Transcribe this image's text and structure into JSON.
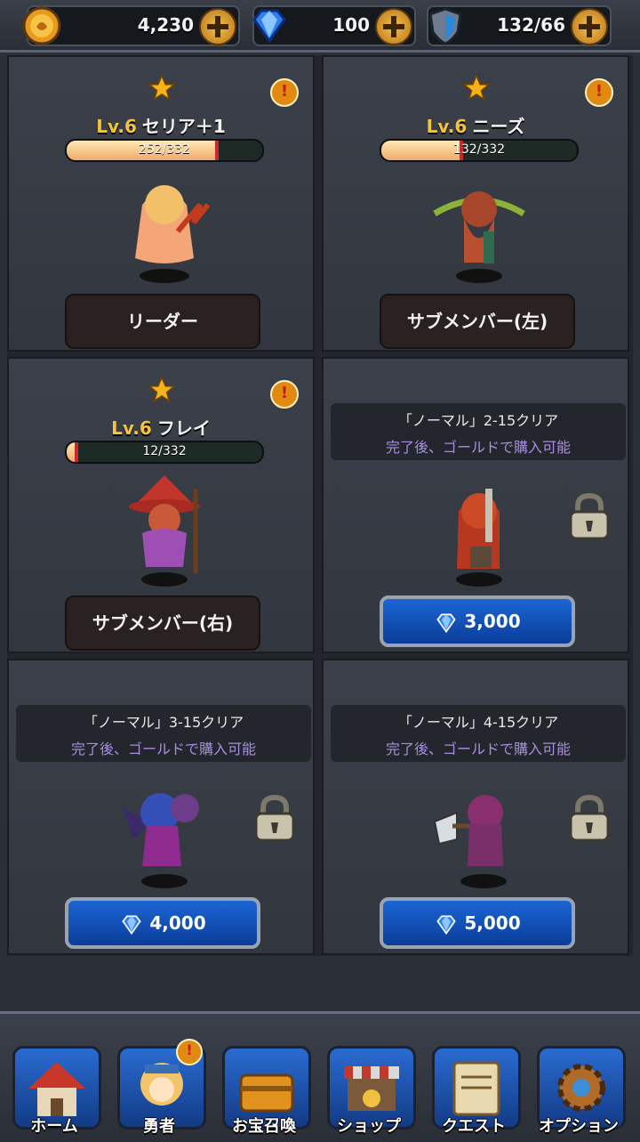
{
  "top_bar": {
    "gold": "4,230",
    "gems": "100",
    "stamina": "132/66"
  },
  "heroes": [
    {
      "lv": "Lv.6",
      "name": "セリア＋1",
      "xp": "252/332",
      "xp_fraction": 0.76,
      "slot": "リーダー"
    },
    {
      "lv": "Lv.6",
      "name": "ニーズ",
      "xp": "132/332",
      "xp_fraction": 0.4,
      "slot": "サブメンバー(左)"
    },
    {
      "lv": "Lv.6",
      "name": "フレイ",
      "xp": "12/332",
      "xp_fraction": 0.04,
      "slot": "サブメンバー(右)"
    }
  ],
  "locked": [
    {
      "condition": "「ノーマル」2-15クリア",
      "note": "完了後、ゴールドで購入可能",
      "price": "3,000"
    },
    {
      "condition": "「ノーマル」3-15クリア",
      "note": "完了後、ゴールドで購入可能",
      "price": "4,000"
    },
    {
      "condition": "「ノーマル」4-15クリア",
      "note": "完了後、ゴールドで購入可能",
      "price": "5,000"
    }
  ],
  "nav": [
    {
      "label": "ホーム",
      "icon": "house-icon"
    },
    {
      "label": "勇者",
      "icon": "hero-icon"
    },
    {
      "label": "お宝召喚",
      "icon": "treasure-chest-icon"
    },
    {
      "label": "ショップ",
      "icon": "shop-icon"
    },
    {
      "label": "クエスト",
      "icon": "scroll-icon"
    },
    {
      "label": "オプション",
      "icon": "gear-icon"
    }
  ],
  "colors": {
    "accent_gold": "#f2c340",
    "button_blue": "#1b66d4",
    "locked_note": "#a98de0"
  }
}
